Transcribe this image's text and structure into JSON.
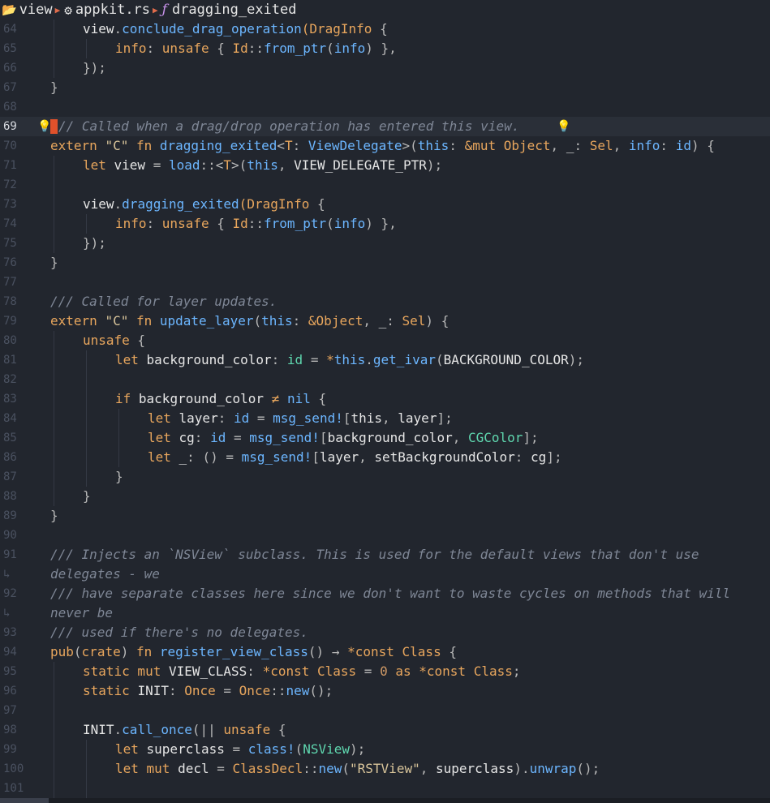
{
  "breadcrumb": [
    {
      "icon": "folder-icon",
      "label": "view"
    },
    {
      "icon": "rust-file-icon",
      "label": "appkit.rs"
    },
    {
      "icon": "function-icon",
      "label": "dragging_exited"
    }
  ],
  "current_line": 69,
  "lines": [
    {
      "num": "64",
      "indent": 1,
      "tokens": [
        [
          "view",
          "v"
        ],
        [
          ".",
          "p"
        ],
        [
          "conclude_drag_operation",
          "f"
        ],
        [
          "(",
          "t"
        ],
        [
          "DragInfo",
          "t"
        ],
        [
          " {",
          "p"
        ]
      ]
    },
    {
      "num": "65",
      "indent": 2,
      "tokens": [
        [
          "info",
          "t"
        ],
        [
          ": ",
          "p"
        ],
        [
          "unsafe",
          "k"
        ],
        [
          " { ",
          "p"
        ],
        [
          "Id",
          "t"
        ],
        [
          "::",
          "p"
        ],
        [
          "from_ptr",
          "f"
        ],
        [
          "(",
          "p"
        ],
        [
          "info",
          "f"
        ],
        [
          ") },",
          "p"
        ]
      ]
    },
    {
      "num": "66",
      "indent": 1,
      "tokens": [
        [
          "});",
          "p"
        ]
      ]
    },
    {
      "num": "67",
      "indent": 0,
      "tokens": [
        [
          "}",
          "p"
        ]
      ]
    },
    {
      "num": "68",
      "indent": 0,
      "tokens": []
    },
    {
      "num": "69",
      "indent": 0,
      "tokens": [
        [
          "// Called when a drag/drop operation has entered this view.",
          "c"
        ]
      ],
      "current": true,
      "bulb_before": true,
      "bulb_after": true
    },
    {
      "num": "70",
      "indent": 0,
      "tokens": [
        [
          "extern ",
          "k"
        ],
        [
          "\"C\"",
          "s"
        ],
        [
          " fn ",
          "k"
        ],
        [
          "dragging_exited",
          "f"
        ],
        [
          "<",
          "p"
        ],
        [
          "T",
          "t"
        ],
        [
          ": ",
          "p"
        ],
        [
          "ViewDelegate",
          "f"
        ],
        [
          ">(",
          "p"
        ],
        [
          "this",
          "f"
        ],
        [
          ": ",
          "p"
        ],
        [
          "&mut ",
          "k"
        ],
        [
          "Object",
          "t"
        ],
        [
          ", ",
          "p"
        ],
        [
          "_",
          "v"
        ],
        [
          ": ",
          "p"
        ],
        [
          "Sel",
          "t"
        ],
        [
          ", ",
          "p"
        ],
        [
          "info",
          "f"
        ],
        [
          ": ",
          "p"
        ],
        [
          "id",
          "f"
        ],
        [
          ") {",
          "p"
        ]
      ]
    },
    {
      "num": "71",
      "indent": 1,
      "tokens": [
        [
          "let ",
          "k"
        ],
        [
          "view",
          "v"
        ],
        [
          " = ",
          "p"
        ],
        [
          "load",
          "f"
        ],
        [
          "::<",
          "p"
        ],
        [
          "T",
          "t"
        ],
        [
          ">(",
          "p"
        ],
        [
          "this",
          "f"
        ],
        [
          ", ",
          "p"
        ],
        [
          "VIEW_DELEGATE_PTR",
          "v"
        ],
        [
          ");",
          "p"
        ]
      ]
    },
    {
      "num": "72",
      "indent": 1,
      "tokens": []
    },
    {
      "num": "73",
      "indent": 1,
      "tokens": [
        [
          "view",
          "v"
        ],
        [
          ".",
          "p"
        ],
        [
          "dragging_exited",
          "f"
        ],
        [
          "(",
          "t"
        ],
        [
          "DragInfo",
          "t"
        ],
        [
          " {",
          "p"
        ]
      ]
    },
    {
      "num": "74",
      "indent": 2,
      "tokens": [
        [
          "info",
          "t"
        ],
        [
          ": ",
          "p"
        ],
        [
          "unsafe",
          "k"
        ],
        [
          " { ",
          "p"
        ],
        [
          "Id",
          "t"
        ],
        [
          "::",
          "p"
        ],
        [
          "from_ptr",
          "f"
        ],
        [
          "(",
          "p"
        ],
        [
          "info",
          "f"
        ],
        [
          ") },",
          "p"
        ]
      ]
    },
    {
      "num": "75",
      "indent": 1,
      "tokens": [
        [
          "});",
          "p"
        ]
      ]
    },
    {
      "num": "76",
      "indent": 0,
      "tokens": [
        [
          "}",
          "p"
        ]
      ]
    },
    {
      "num": "77",
      "indent": 0,
      "tokens": []
    },
    {
      "num": "78",
      "indent": 0,
      "tokens": [
        [
          "/// Called for layer updates.",
          "c"
        ]
      ]
    },
    {
      "num": "79",
      "indent": 0,
      "tokens": [
        [
          "extern ",
          "k"
        ],
        [
          "\"C\"",
          "s"
        ],
        [
          " fn ",
          "k"
        ],
        [
          "update_layer",
          "f"
        ],
        [
          "(",
          "p"
        ],
        [
          "this",
          "f"
        ],
        [
          ": ",
          "p"
        ],
        [
          "&",
          "k"
        ],
        [
          "Object",
          "t"
        ],
        [
          ", ",
          "p"
        ],
        [
          "_",
          "v"
        ],
        [
          ": ",
          "p"
        ],
        [
          "Sel",
          "t"
        ],
        [
          ") {",
          "p"
        ]
      ]
    },
    {
      "num": "80",
      "indent": 1,
      "tokens": [
        [
          "unsafe",
          "k"
        ],
        [
          " {",
          "p"
        ]
      ]
    },
    {
      "num": "81",
      "indent": 2,
      "tokens": [
        [
          "let ",
          "k"
        ],
        [
          "background_color",
          "v"
        ],
        [
          ": ",
          "p"
        ],
        [
          "id",
          "sc"
        ],
        [
          " = ",
          "p"
        ],
        [
          "*",
          "k"
        ],
        [
          "this",
          "f"
        ],
        [
          ".",
          "p"
        ],
        [
          "get_ivar",
          "f"
        ],
        [
          "(",
          "p"
        ],
        [
          "BACKGROUND_COLOR",
          "v"
        ],
        [
          ");",
          "p"
        ]
      ]
    },
    {
      "num": "82",
      "indent": 2,
      "tokens": []
    },
    {
      "num": "83",
      "indent": 2,
      "tokens": [
        [
          "if ",
          "k"
        ],
        [
          "background_color",
          "v"
        ],
        [
          " ≠ ",
          "k"
        ],
        [
          "nil",
          "f"
        ],
        [
          " {",
          "p"
        ]
      ]
    },
    {
      "num": "84",
      "indent": 3,
      "tokens": [
        [
          "let ",
          "k"
        ],
        [
          "layer",
          "v"
        ],
        [
          ": ",
          "p"
        ],
        [
          "id",
          "f"
        ],
        [
          " = ",
          "p"
        ],
        [
          "msg_send!",
          "f"
        ],
        [
          "[",
          "p"
        ],
        [
          "this",
          "v"
        ],
        [
          ", ",
          "p"
        ],
        [
          "layer",
          "v"
        ],
        [
          "];",
          "p"
        ]
      ]
    },
    {
      "num": "85",
      "indent": 3,
      "tokens": [
        [
          "let ",
          "k"
        ],
        [
          "cg",
          "v"
        ],
        [
          ": ",
          "p"
        ],
        [
          "id",
          "f"
        ],
        [
          " = ",
          "p"
        ],
        [
          "msg_send!",
          "f"
        ],
        [
          "[",
          "p"
        ],
        [
          "background_color",
          "v"
        ],
        [
          ", ",
          "p"
        ],
        [
          "CGColor",
          "sc"
        ],
        [
          "];",
          "p"
        ]
      ]
    },
    {
      "num": "86",
      "indent": 3,
      "tokens": [
        [
          "let ",
          "k"
        ],
        [
          "_",
          "v"
        ],
        [
          ": () = ",
          "p"
        ],
        [
          "msg_send!",
          "f"
        ],
        [
          "[",
          "p"
        ],
        [
          "layer",
          "v"
        ],
        [
          ", ",
          "p"
        ],
        [
          "setBackgroundColor",
          "v"
        ],
        [
          ": ",
          "p"
        ],
        [
          "cg",
          "v"
        ],
        [
          "];",
          "p"
        ]
      ]
    },
    {
      "num": "87",
      "indent": 2,
      "tokens": [
        [
          "}",
          "p"
        ]
      ]
    },
    {
      "num": "88",
      "indent": 1,
      "tokens": [
        [
          "}",
          "p"
        ]
      ]
    },
    {
      "num": "89",
      "indent": 0,
      "tokens": [
        [
          "}",
          "p"
        ]
      ]
    },
    {
      "num": "90",
      "indent": 0,
      "tokens": []
    },
    {
      "num": "91",
      "indent": 0,
      "tokens": [
        [
          "/// Injects an `NSView` subclass. This is used for the default views that don't use",
          "c"
        ]
      ]
    },
    {
      "num": "↳",
      "indent": 0,
      "tokens": [
        [
          "delegates - we",
          "c"
        ]
      ]
    },
    {
      "num": "92",
      "indent": 0,
      "tokens": [
        [
          "/// have separate classes here since we don't want to waste cycles on methods that will",
          "c"
        ]
      ]
    },
    {
      "num": "↳",
      "indent": 0,
      "tokens": [
        [
          "never be",
          "c"
        ]
      ]
    },
    {
      "num": "93",
      "indent": 0,
      "tokens": [
        [
          "/// used if there's no delegates.",
          "c"
        ]
      ]
    },
    {
      "num": "94",
      "indent": 0,
      "tokens": [
        [
          "pub",
          "k"
        ],
        [
          "(",
          "p"
        ],
        [
          "crate",
          "k"
        ],
        [
          ") ",
          "p"
        ],
        [
          "fn ",
          "k"
        ],
        [
          "register_view_class",
          "f"
        ],
        [
          "() → ",
          "p"
        ],
        [
          "*const ",
          "k"
        ],
        [
          "Class",
          "t"
        ],
        [
          " {",
          "p"
        ]
      ]
    },
    {
      "num": "95",
      "indent": 1,
      "tokens": [
        [
          "static mut ",
          "k"
        ],
        [
          "VIEW_CLASS",
          "v"
        ],
        [
          ": ",
          "p"
        ],
        [
          "*const ",
          "k"
        ],
        [
          "Class",
          "t"
        ],
        [
          " = ",
          "p"
        ],
        [
          "0",
          "n"
        ],
        [
          " as ",
          "k"
        ],
        [
          "*const ",
          "k"
        ],
        [
          "Class",
          "t"
        ],
        [
          ";",
          "p"
        ]
      ]
    },
    {
      "num": "96",
      "indent": 1,
      "tokens": [
        [
          "static ",
          "k"
        ],
        [
          "INIT",
          "v"
        ],
        [
          ": ",
          "p"
        ],
        [
          "Once",
          "t"
        ],
        [
          " = ",
          "p"
        ],
        [
          "Once",
          "t"
        ],
        [
          "::",
          "p"
        ],
        [
          "new",
          "f"
        ],
        [
          "();",
          "p"
        ]
      ]
    },
    {
      "num": "97",
      "indent": 1,
      "tokens": []
    },
    {
      "num": "98",
      "indent": 1,
      "tokens": [
        [
          "INIT",
          "v"
        ],
        [
          ".",
          "p"
        ],
        [
          "call_once",
          "f"
        ],
        [
          "(|| ",
          "p"
        ],
        [
          "unsafe",
          "k"
        ],
        [
          " {",
          "p"
        ]
      ]
    },
    {
      "num": "99",
      "indent": 2,
      "tokens": [
        [
          "let ",
          "k"
        ],
        [
          "superclass",
          "v"
        ],
        [
          " = ",
          "p"
        ],
        [
          "class!",
          "f"
        ],
        [
          "(",
          "p"
        ],
        [
          "NSView",
          "sc"
        ],
        [
          ");",
          "p"
        ]
      ]
    },
    {
      "num": "100",
      "indent": 2,
      "tokens": [
        [
          "let mut ",
          "k"
        ],
        [
          "decl",
          "v"
        ],
        [
          " = ",
          "p"
        ],
        [
          "ClassDecl",
          "t"
        ],
        [
          "::",
          "p"
        ],
        [
          "new",
          "f"
        ],
        [
          "(",
          "p"
        ],
        [
          "\"RSTView\"",
          "s"
        ],
        [
          ", ",
          "p"
        ],
        [
          "superclass",
          "v"
        ],
        [
          ").",
          "p"
        ],
        [
          "unwrap",
          "f"
        ],
        [
          "();",
          "p"
        ]
      ]
    },
    {
      "num": "101",
      "indent": 2,
      "tokens": []
    }
  ]
}
